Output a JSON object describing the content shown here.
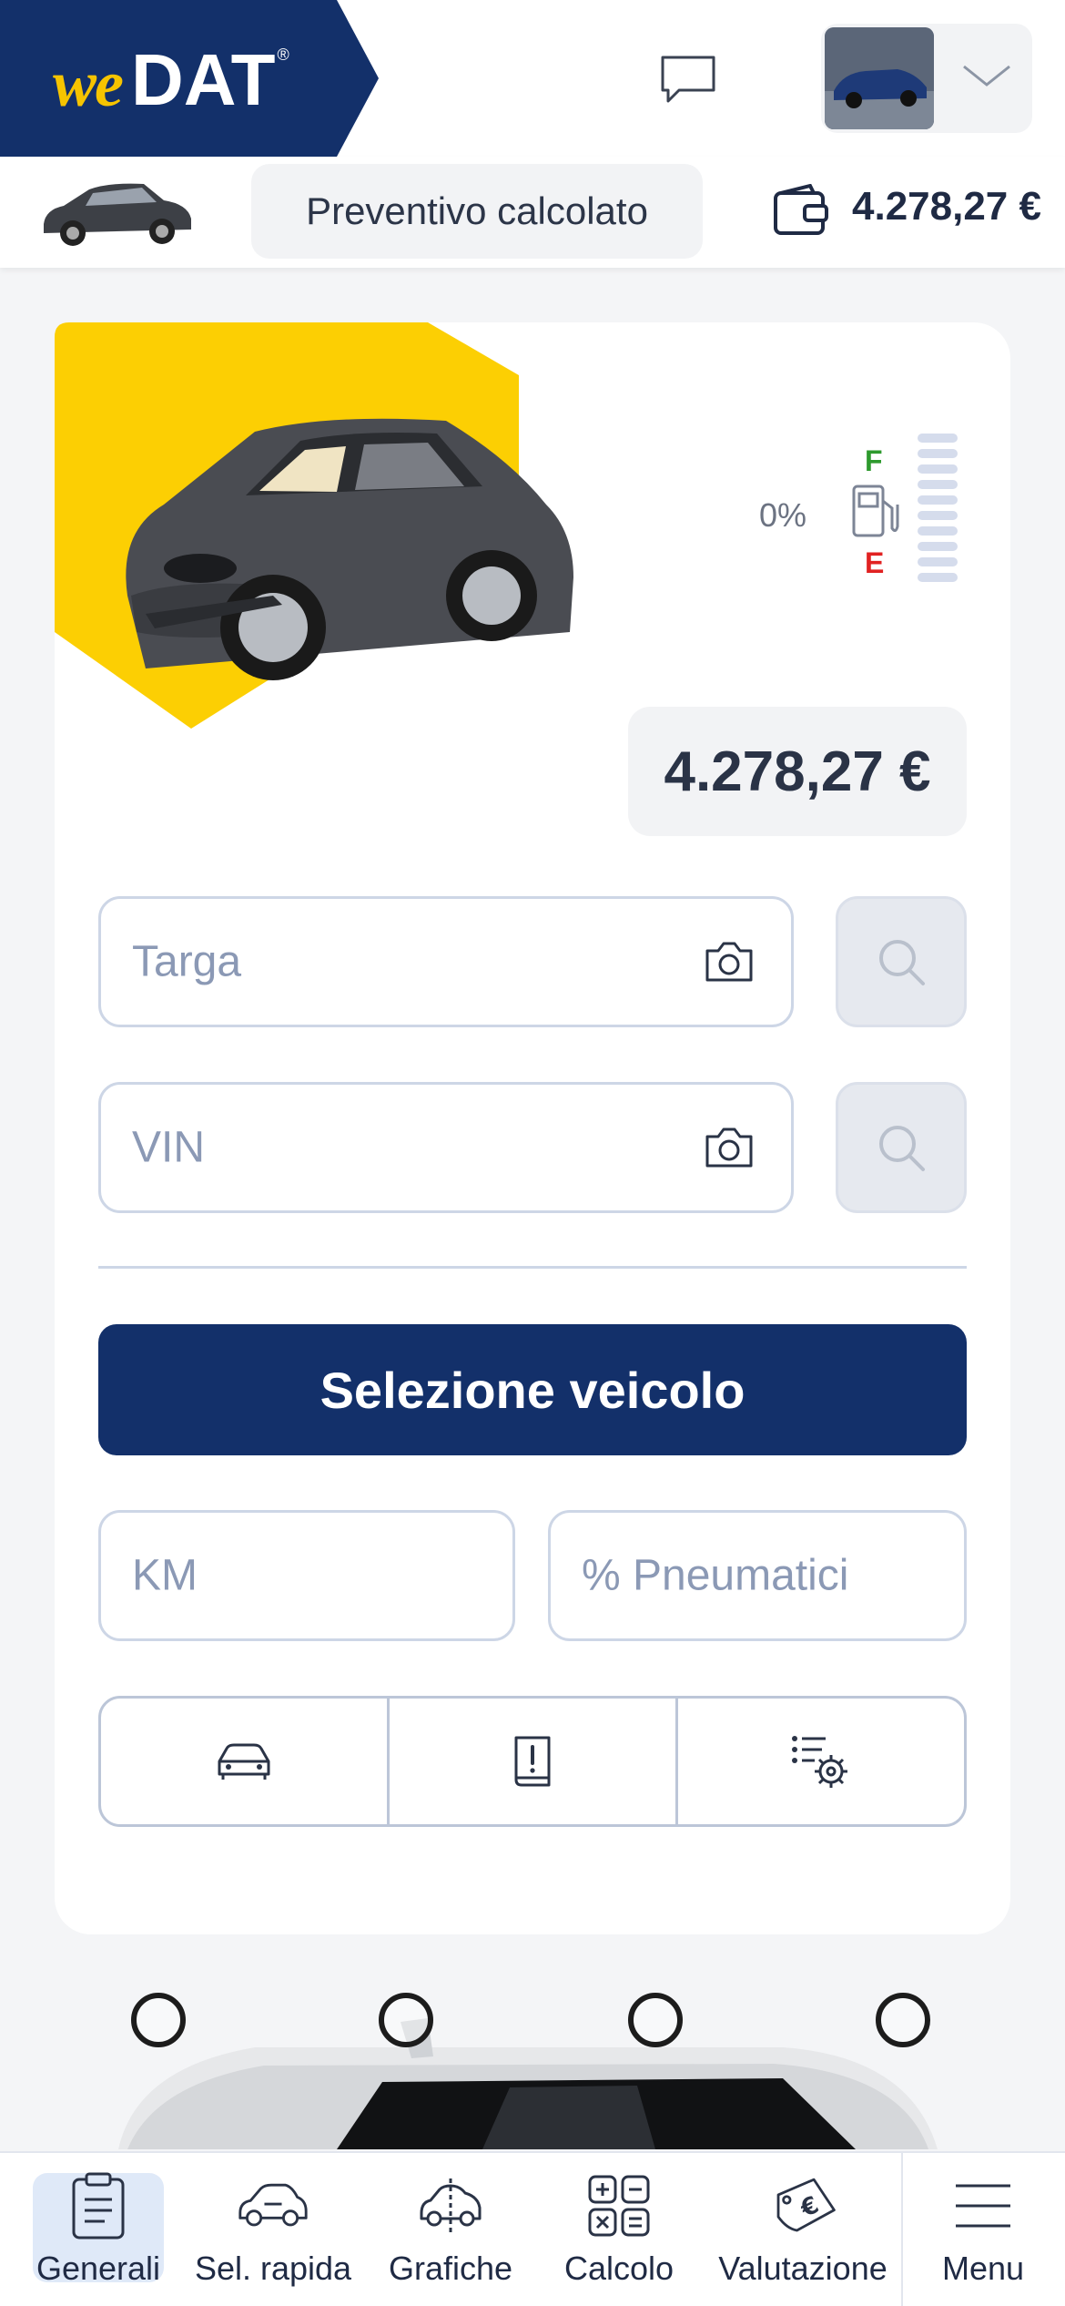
{
  "header": {
    "logo_we": "we",
    "logo_dat": "DAT",
    "logo_reg": "®"
  },
  "subheader": {
    "status_chip": "Preventivo calcolato",
    "total_price": "4.278,27 €"
  },
  "vehicle": {
    "fuel_level": "0%",
    "fuel_full": "F",
    "fuel_empty": "E",
    "price": "4.278,27 €"
  },
  "form": {
    "plate_placeholder": "Targa",
    "vin_placeholder": "VIN",
    "select_vehicle_label": "Selezione veicolo",
    "km_placeholder": "KM",
    "tires_placeholder": "% Pneumatici"
  },
  "bottom_nav": {
    "items": [
      {
        "label": "Generali",
        "icon": "clipboard-icon",
        "active": true
      },
      {
        "label": "Sel. rapida",
        "icon": "car-outline-icon"
      },
      {
        "label": "Grafiche",
        "icon": "car-graphic-icon"
      },
      {
        "label": "Calcolo",
        "icon": "calculator-icon"
      },
      {
        "label": "Valutazione",
        "icon": "euro-tag-icon"
      },
      {
        "label": "Menu",
        "icon": "hamburger-icon"
      }
    ]
  },
  "colors": {
    "brand_navy": "#13306a",
    "brand_yellow": "#f6c400",
    "active_nav_bg": "#dfe9f8"
  }
}
